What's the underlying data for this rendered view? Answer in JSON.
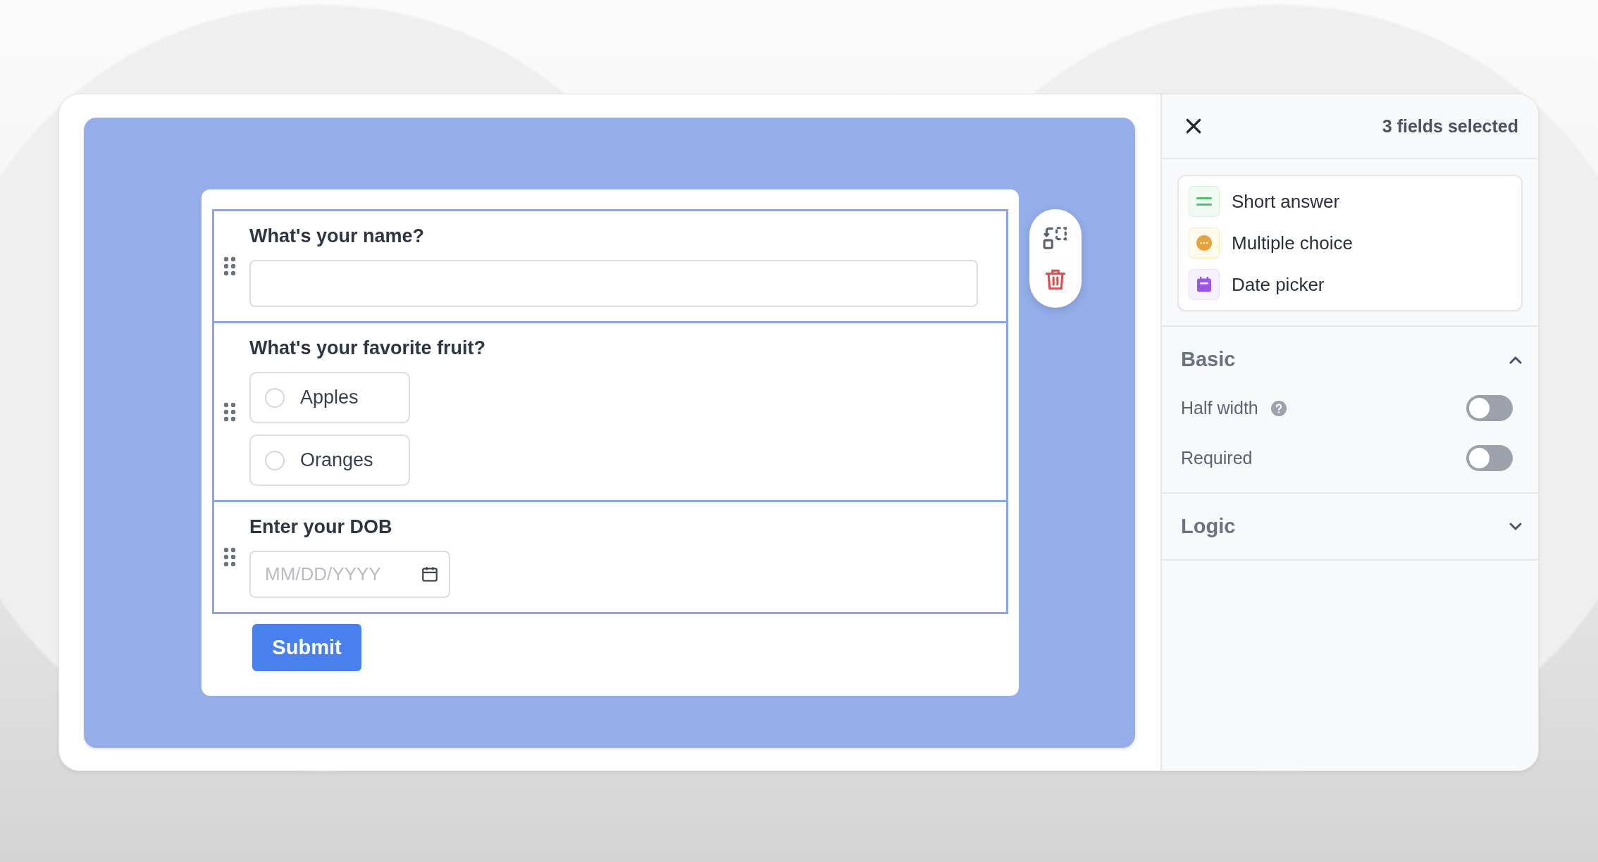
{
  "form": {
    "fields": [
      {
        "kind": "text",
        "label": "What's your name?",
        "selected": true
      },
      {
        "kind": "choice",
        "label": "What's your favorite fruit?",
        "selected": true,
        "options": [
          {
            "label": "Apples",
            "selected": false
          },
          {
            "label": "Oranges",
            "selected": false
          }
        ]
      },
      {
        "kind": "date",
        "label": "Enter your DOB",
        "placeholder": "MM/DD/YYYY",
        "selected": true
      }
    ],
    "submit": "Submit"
  },
  "panel": {
    "title": "3 fields selected",
    "field_types": [
      {
        "kind": "short",
        "label": "Short answer"
      },
      {
        "kind": "choice",
        "label": "Multiple choice"
      },
      {
        "kind": "date",
        "label": "Date picker"
      }
    ],
    "sections": [
      {
        "title": "Basic",
        "expanded": true,
        "settings": [
          {
            "label": "Half width",
            "help": true,
            "on": false
          },
          {
            "label": "Required",
            "help": false,
            "on": false
          }
        ]
      },
      {
        "title": "Logic",
        "expanded": false
      }
    ]
  }
}
